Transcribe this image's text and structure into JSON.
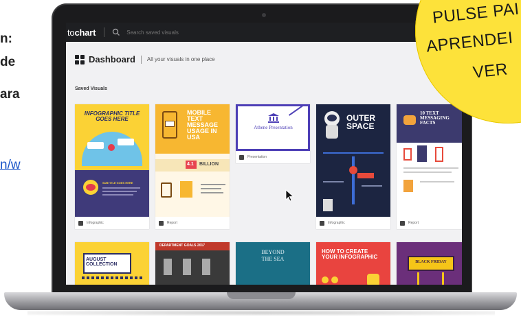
{
  "slide_fragment": {
    "line1": "n:",
    "line2": "de",
    "line3": "ara",
    "link": "n/w"
  },
  "app": {
    "logo_prefix": "to",
    "logo_bold": "chart",
    "search_placeholder": "Search saved visuals",
    "dashboard_title": "Dashboard",
    "dashboard_subtitle": "All your visuals in one place",
    "section_label": "Saved Visuals"
  },
  "cards": [
    {
      "title": "INFOGRAPHIC TITLE GOES HERE",
      "sub": "SUBTITLE GOES HERE",
      "type": "Infographic"
    },
    {
      "title": "MOBILE TEXT MESSAGE USAGE IN USA",
      "stat": "4.1",
      "stat_label": "BILLION",
      "type": "Report"
    },
    {
      "title": "Athene Presentation",
      "type": "Presentation"
    },
    {
      "title": "OUTER SPACE",
      "type": "Infographic"
    },
    {
      "title": "10 TEXT MESSAGING FACTS",
      "type": "Report"
    },
    {
      "title": "AUGUST COLLECTION"
    },
    {
      "title": "DEPARTMENT GOALS 2017"
    },
    {
      "title": "BEYOND THE SEA"
    },
    {
      "title": "HOW TO CREATE YOUR INFOGRAPHIC"
    },
    {
      "title": "BLACK FRIDAY"
    }
  ],
  "badge": {
    "line1": "PULSE PAI",
    "line2": "APRENDEI",
    "line3": "VER"
  },
  "colors": {
    "topbar": "#1e1f22",
    "screen_bg": "#f1f1f3",
    "badge": "#fde23a",
    "link": "#1a55c8"
  }
}
